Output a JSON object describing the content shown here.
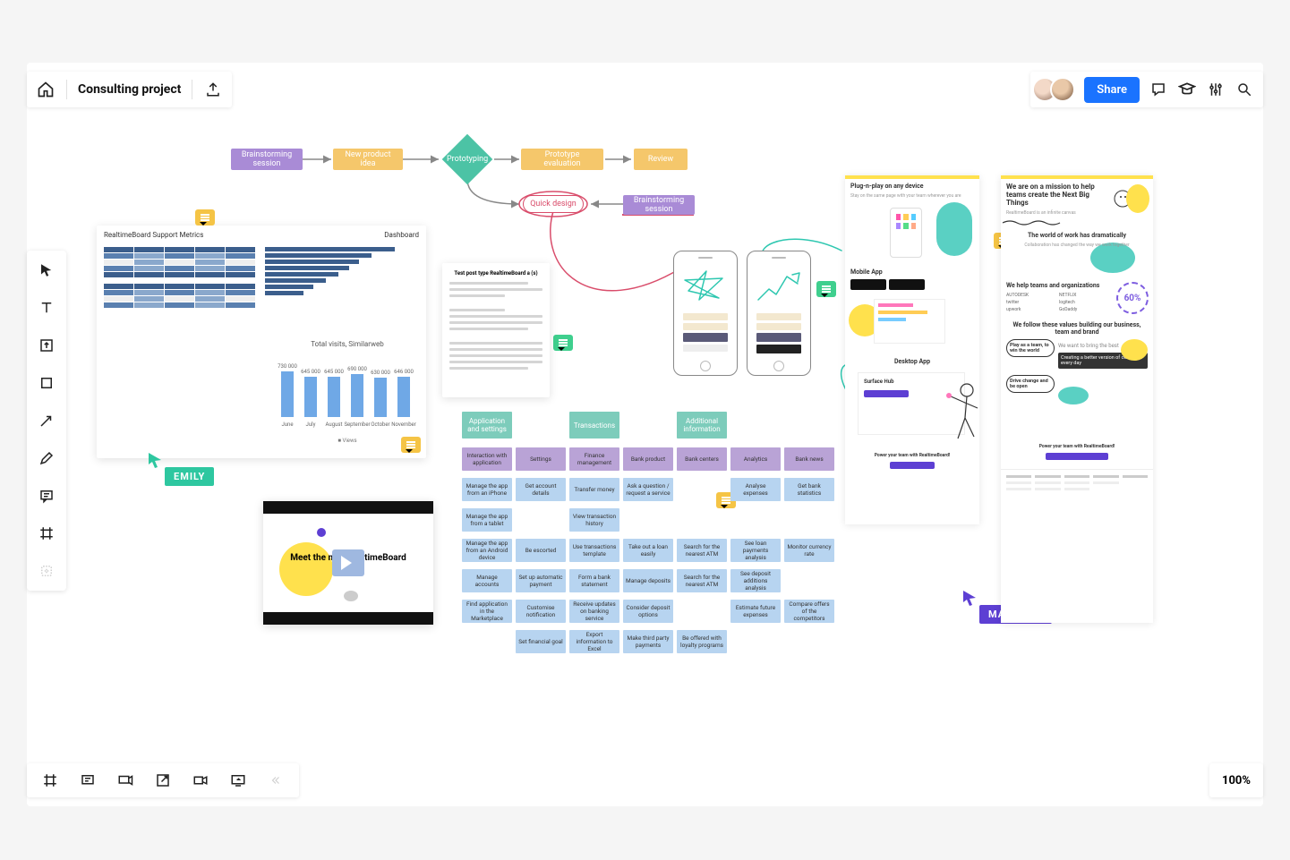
{
  "header": {
    "title": "Consulting project",
    "share_label": "Share"
  },
  "zoom": "100%",
  "cursors": {
    "emily": "EMILY",
    "matthew": "MATTHEW"
  },
  "flow": {
    "n1": "Brainstorming session",
    "n2": "New product idea",
    "n3": "Prototyping",
    "n4": "Prototype evaluation",
    "n5": "Review",
    "n6": "Quick design",
    "n7": "Brainstorming session"
  },
  "dashboard": {
    "title": "RealtimeBoard Support Metrics",
    "right": "Dashboard",
    "chart_title": "Total visits, Similarweb",
    "legend": "Views"
  },
  "chart_data": {
    "type": "bar",
    "title": "Total visits, Similarweb",
    "categories": [
      "June",
      "July",
      "August",
      "September",
      "October",
      "November"
    ],
    "values": [
      730000,
      645000,
      645000,
      690000,
      630000,
      645700
    ],
    "ylabel": "",
    "ylim": [
      0,
      1000000
    ]
  },
  "video": {
    "title": "Meet the new RealtimeBoard"
  },
  "stickies": {
    "headers": {
      "h1": "Application and settings",
      "h2": "Transactions",
      "h3": "Additional information"
    },
    "row_purple": [
      "Interaction with application",
      "Settings",
      "Finance management",
      "Bank product",
      "Bank centers",
      "Analytics",
      "Bank news"
    ],
    "rows": [
      [
        "Manage the app from an iPhone",
        "Get account details",
        "Transfer money",
        "Ask a question / request a service",
        "",
        "Analyse expenses",
        "Get bank statistics"
      ],
      [
        "Manage the app from a tablet",
        "",
        "View transaction history",
        "",
        "",
        "",
        ""
      ],
      [
        "Manage the app from an Android device",
        "Be escorted",
        "Use transactions template",
        "Take out a loan easily",
        "Search for the nearest ATM",
        "See loan payments analysis",
        "Monitor currency rate"
      ],
      [
        "Manage accounts",
        "Set up automatic payment",
        "Form a bank statement",
        "Manage deposits",
        "Search for the nearest ATM",
        "See deposit additions analysis",
        ""
      ],
      [
        "Find application in the Marketplace",
        "Customise notification",
        "Receive updates on banking service",
        "Consider deposit options",
        "",
        "Estimate future expenses",
        "Compare offers of the competitors"
      ],
      [
        "",
        "Set financial goal",
        "Export information to Excel",
        "Make third party payments",
        "Be offered with loyalty programs",
        "",
        ""
      ]
    ]
  },
  "doc": {
    "title": "Test post type RealtimeBoard a (s)"
  },
  "mockups": {
    "left": {
      "h1": "Plug-n-play on any device",
      "sub1": "Stay on the same page with your team wherever you are",
      "h2": "Mobile App",
      "h3": "Desktop App",
      "h4": "Surface Hub",
      "foot": "Power your team with RealtimeBoard!"
    },
    "right": {
      "h1": "We are on a mission to help teams create the Next Big Things",
      "h2": "The world of work has dramatically",
      "h3": "We help teams and organizations",
      "stat": "60%",
      "brands": [
        "AUTODESK",
        "NETFLIX",
        "twitter",
        "logitech",
        "upwork",
        "GoDaddy"
      ],
      "h4": "We follow these values building our business, team and brand",
      "v1": "Play as a team, to win the world",
      "v2": "Creating a better version of ourselves every day",
      "v3": "Drive change and be open",
      "foot": "Power your team with RealtimeBoard!"
    }
  }
}
